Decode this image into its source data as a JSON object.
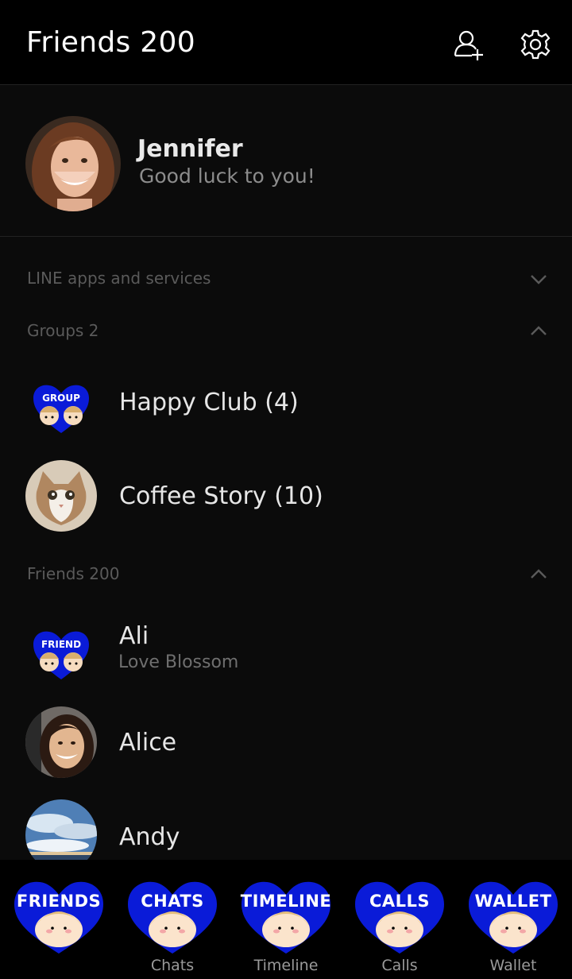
{
  "header": {
    "title": "Friends 200"
  },
  "profile": {
    "name": "Jennifer",
    "status": "Good luck to you!"
  },
  "sections": {
    "services": {
      "label": "LINE apps and services"
    },
    "groups": {
      "label": "Groups 2"
    },
    "friends": {
      "label": "Friends 200"
    }
  },
  "groups": [
    {
      "name": "Happy Club (4)",
      "badge": "GROUP"
    },
    {
      "name": "Coffee Story (10)"
    }
  ],
  "friends": [
    {
      "name": "Ali",
      "status": "Love Blossom",
      "badge": "FRIEND"
    },
    {
      "name": "Alice"
    },
    {
      "name": "Andy"
    }
  ],
  "tabs": [
    {
      "heart": "FRIENDS",
      "caption": ""
    },
    {
      "heart": "CHATS",
      "caption": "Chats"
    },
    {
      "heart": "TIMELINE",
      "caption": "Timeline"
    },
    {
      "heart": "CALLS",
      "caption": "Calls"
    },
    {
      "heart": "WALLET",
      "caption": "Wallet"
    }
  ],
  "colors": {
    "accent": "#0a1bd8",
    "background": "#0b0b0b",
    "header": "#000000"
  },
  "icons": {
    "add_friend": "add-friend-icon",
    "settings": "gear-icon",
    "collapse": "chevron-up-icon",
    "expand": "chevron-down-icon"
  }
}
